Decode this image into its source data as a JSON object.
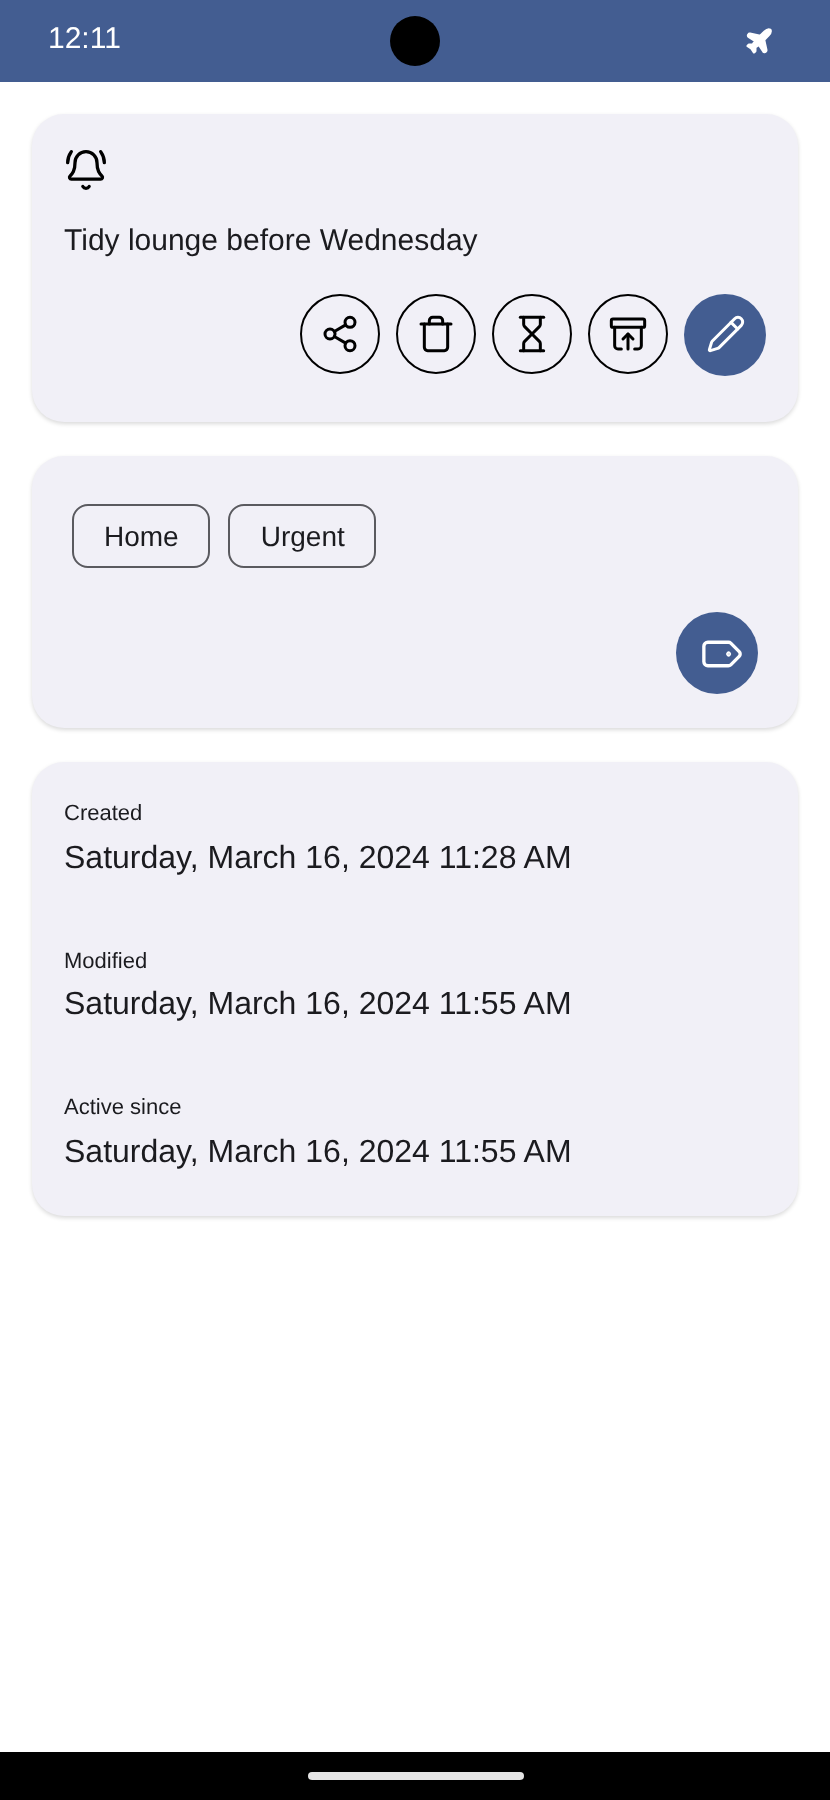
{
  "status_bar": {
    "time": "12:11"
  },
  "note": {
    "title": "Tidy lounge before Wednesday",
    "actions": [
      {
        "kind": "share",
        "filled": false
      },
      {
        "kind": "delete",
        "filled": false
      },
      {
        "kind": "snooze",
        "filled": false
      },
      {
        "kind": "archive",
        "filled": false
      },
      {
        "kind": "edit",
        "filled": true
      }
    ]
  },
  "labels": {
    "tags": [
      "Home",
      "Urgent"
    ]
  },
  "info": [
    {
      "label": "Created",
      "value": "Saturday, March 16, 2024 11:28 AM"
    },
    {
      "label": "Modified",
      "value": "Saturday, March 16, 2024 11:55 AM"
    },
    {
      "label": "Active since",
      "value": "Saturday, March 16, 2024 11:55 AM"
    }
  ]
}
